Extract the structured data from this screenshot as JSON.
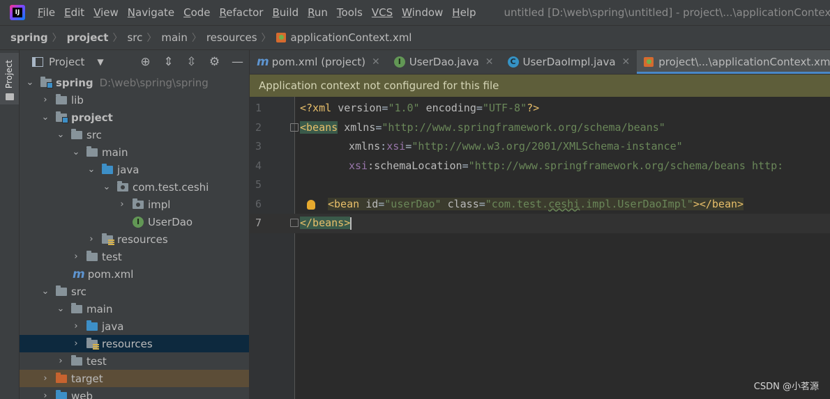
{
  "menu": {
    "logo_text": "IJ",
    "items": [
      {
        "first": "F",
        "rest": "ile"
      },
      {
        "first": "E",
        "rest": "dit"
      },
      {
        "first": "V",
        "rest": "iew"
      },
      {
        "first": "N",
        "rest": "avigate"
      },
      {
        "first": "C",
        "rest": "ode"
      },
      {
        "first": "R",
        "rest": "efactor"
      },
      {
        "first": "B",
        "rest": "uild"
      },
      {
        "first": "R",
        "rest": "un"
      },
      {
        "first": "T",
        "rest": "ools"
      },
      {
        "first": "VCS",
        "rest": ""
      },
      {
        "first": "W",
        "rest": "indow"
      },
      {
        "first": "H",
        "rest": "elp"
      }
    ],
    "window_title": "untitled [D:\\web\\spring\\untitled] - project\\...\\applicationContext.xml"
  },
  "breadcrumb": [
    "spring",
    "project",
    "src",
    "main",
    "resources",
    "applicationContext.xml"
  ],
  "sidebar_stripe": {
    "label": "Project"
  },
  "project_panel": {
    "title": "Project",
    "tools": [
      "target-icon",
      "expand-all-icon",
      "collapse-all-icon",
      "gear-icon",
      "minimize-icon"
    ],
    "tree": [
      {
        "label": "spring",
        "path": "D:\\web\\spring\\spring",
        "bold": true
      },
      {
        "label": "lib"
      },
      {
        "label": "project",
        "bold": true
      },
      {
        "label": "src"
      },
      {
        "label": "main"
      },
      {
        "label": "java"
      },
      {
        "label": "com.test.ceshi"
      },
      {
        "label": "impl"
      },
      {
        "label": "UserDao"
      },
      {
        "label": "resources"
      },
      {
        "label": "test"
      },
      {
        "label": "pom.xml"
      },
      {
        "label": "src"
      },
      {
        "label": "main"
      },
      {
        "label": "java"
      },
      {
        "label": "resources"
      },
      {
        "label": "test"
      },
      {
        "label": "target"
      },
      {
        "label": "web"
      }
    ]
  },
  "tabs": [
    {
      "label": "pom.xml (project)",
      "icon": "maven-icon",
      "active": false
    },
    {
      "label": "UserDao.java",
      "icon": "interface-icon",
      "active": false
    },
    {
      "label": "UserDaoImpl.java",
      "icon": "class-icon",
      "active": false
    },
    {
      "label": "project\\...\\applicationContext.xml",
      "icon": "xml-spring-icon",
      "active": true
    }
  ],
  "banner": {
    "text": "Application context not configured for this file"
  },
  "editor": {
    "line_numbers": [
      "1",
      "2",
      "3",
      "4",
      "5",
      "6",
      "7"
    ],
    "current_line": "7",
    "lines": {
      "l1": {
        "a": "<?xml ",
        "b": "version",
        "c": "=",
        "d": "\"1.0\"",
        "e": " ",
        "f": "encoding",
        "g": "=",
        "h": "\"UTF-8\"",
        "i": "?>"
      },
      "l2": {
        "a": "<beans",
        "b": " ",
        "c": "xmlns",
        "d": "=",
        "e": "\"http://www.springframework.org/schema/beans\""
      },
      "l3": {
        "a": "xmlns",
        "b": ":",
        "c": "xsi",
        "d": "=",
        "e": "\"http://www.w3.org/2001/XMLSchema-instance\""
      },
      "l4": {
        "a": "xsi",
        "b": ":schemaLocation",
        "c": "=",
        "d": "\"http://www.springframework.org/schema/beans http:"
      },
      "l6": {
        "a": "<bean ",
        "b": "id",
        "c": "=",
        "d": "\"userDao\"",
        "e": " ",
        "f": "class",
        "g": "=",
        "h": "\"com.test.",
        "i": "ceshi",
        "j": ".impl.UserDaoImpl\"",
        "k": "></bean>"
      },
      "l7": {
        "a": "</beans>"
      }
    }
  },
  "watermark": "CSDN @小茗源",
  "colors": {
    "accent": "#4a88c7",
    "banner_bg": "#5e5e3a",
    "selected_row": "#0d293e"
  }
}
